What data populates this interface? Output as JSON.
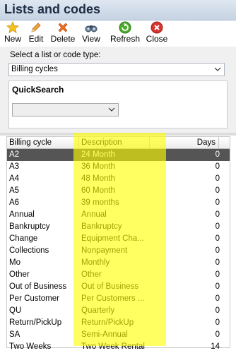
{
  "window": {
    "title": "Lists and codes"
  },
  "toolbar": {
    "new_label": "New",
    "edit_label": "Edit",
    "delete_label": "Delete",
    "view_label": "View",
    "refresh_label": "Refresh",
    "close_label": "Close"
  },
  "selector": {
    "label": "Select a list or code type:",
    "value": "Billing cycles"
  },
  "quicksearch": {
    "title": "QuickSearch",
    "value": ""
  },
  "grid": {
    "columns": [
      "Billing cycle",
      "Description",
      "Days"
    ],
    "rows": [
      {
        "cycle": "A2",
        "description": "24 Month",
        "days": "0"
      },
      {
        "cycle": "A3",
        "description": "36 Month",
        "days": "0"
      },
      {
        "cycle": "A4",
        "description": "48 Month",
        "days": "0"
      },
      {
        "cycle": "A5",
        "description": "60 Month",
        "days": "0"
      },
      {
        "cycle": "A6",
        "description": "39 months",
        "days": "0"
      },
      {
        "cycle": "Annual",
        "description": "Annual",
        "days": "0"
      },
      {
        "cycle": "Bankruptcy",
        "description": "Bankruptcy",
        "days": "0"
      },
      {
        "cycle": "Change",
        "description": "Equipment Cha...",
        "days": "0"
      },
      {
        "cycle": "Collections",
        "description": "Nonpayment",
        "days": "0"
      },
      {
        "cycle": "Mo",
        "description": "Monthly",
        "days": "0"
      },
      {
        "cycle": "Other",
        "description": "Other",
        "days": "0"
      },
      {
        "cycle": "Out of Business",
        "description": "Out of Business",
        "days": "0"
      },
      {
        "cycle": "Per Customer",
        "description": "Per Customers ...",
        "days": "0"
      },
      {
        "cycle": "QU",
        "description": "Quarterly",
        "days": "0"
      },
      {
        "cycle": "Return/PickUp",
        "description": "Return/PickUp",
        "days": "0"
      },
      {
        "cycle": "SA",
        "description": "Semi-Annual",
        "days": "0"
      },
      {
        "cycle": "Two Weeks",
        "description": "Two Week Rental",
        "days": "14"
      }
    ],
    "selected_row": "A2"
  },
  "colors": {
    "highlight": "#ffff00",
    "selected_row": "#555555",
    "title_text": "#1d2d44"
  },
  "icons": {
    "new": "star-icon",
    "edit": "pencil-icon",
    "delete": "x-mark-icon",
    "view": "binoculars-icon",
    "refresh": "refresh-icon",
    "close": "close-circle-icon"
  }
}
